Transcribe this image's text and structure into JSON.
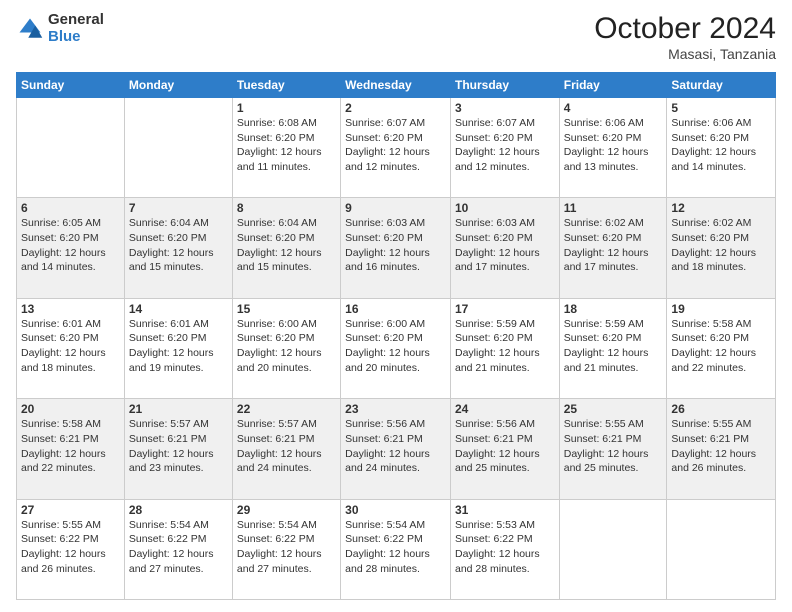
{
  "header": {
    "logo_general": "General",
    "logo_blue": "Blue",
    "month_year": "October 2024",
    "location": "Masasi, Tanzania"
  },
  "days_of_week": [
    "Sunday",
    "Monday",
    "Tuesday",
    "Wednesday",
    "Thursday",
    "Friday",
    "Saturday"
  ],
  "weeks": [
    [
      {
        "day": "",
        "info": ""
      },
      {
        "day": "",
        "info": ""
      },
      {
        "day": "1",
        "info": "Sunrise: 6:08 AM\nSunset: 6:20 PM\nDaylight: 12 hours and 11 minutes."
      },
      {
        "day": "2",
        "info": "Sunrise: 6:07 AM\nSunset: 6:20 PM\nDaylight: 12 hours and 12 minutes."
      },
      {
        "day": "3",
        "info": "Sunrise: 6:07 AM\nSunset: 6:20 PM\nDaylight: 12 hours and 12 minutes."
      },
      {
        "day": "4",
        "info": "Sunrise: 6:06 AM\nSunset: 6:20 PM\nDaylight: 12 hours and 13 minutes."
      },
      {
        "day": "5",
        "info": "Sunrise: 6:06 AM\nSunset: 6:20 PM\nDaylight: 12 hours and 14 minutes."
      }
    ],
    [
      {
        "day": "6",
        "info": "Sunrise: 6:05 AM\nSunset: 6:20 PM\nDaylight: 12 hours and 14 minutes."
      },
      {
        "day": "7",
        "info": "Sunrise: 6:04 AM\nSunset: 6:20 PM\nDaylight: 12 hours and 15 minutes."
      },
      {
        "day": "8",
        "info": "Sunrise: 6:04 AM\nSunset: 6:20 PM\nDaylight: 12 hours and 15 minutes."
      },
      {
        "day": "9",
        "info": "Sunrise: 6:03 AM\nSunset: 6:20 PM\nDaylight: 12 hours and 16 minutes."
      },
      {
        "day": "10",
        "info": "Sunrise: 6:03 AM\nSunset: 6:20 PM\nDaylight: 12 hours and 17 minutes."
      },
      {
        "day": "11",
        "info": "Sunrise: 6:02 AM\nSunset: 6:20 PM\nDaylight: 12 hours and 17 minutes."
      },
      {
        "day": "12",
        "info": "Sunrise: 6:02 AM\nSunset: 6:20 PM\nDaylight: 12 hours and 18 minutes."
      }
    ],
    [
      {
        "day": "13",
        "info": "Sunrise: 6:01 AM\nSunset: 6:20 PM\nDaylight: 12 hours and 18 minutes."
      },
      {
        "day": "14",
        "info": "Sunrise: 6:01 AM\nSunset: 6:20 PM\nDaylight: 12 hours and 19 minutes."
      },
      {
        "day": "15",
        "info": "Sunrise: 6:00 AM\nSunset: 6:20 PM\nDaylight: 12 hours and 20 minutes."
      },
      {
        "day": "16",
        "info": "Sunrise: 6:00 AM\nSunset: 6:20 PM\nDaylight: 12 hours and 20 minutes."
      },
      {
        "day": "17",
        "info": "Sunrise: 5:59 AM\nSunset: 6:20 PM\nDaylight: 12 hours and 21 minutes."
      },
      {
        "day": "18",
        "info": "Sunrise: 5:59 AM\nSunset: 6:20 PM\nDaylight: 12 hours and 21 minutes."
      },
      {
        "day": "19",
        "info": "Sunrise: 5:58 AM\nSunset: 6:20 PM\nDaylight: 12 hours and 22 minutes."
      }
    ],
    [
      {
        "day": "20",
        "info": "Sunrise: 5:58 AM\nSunset: 6:21 PM\nDaylight: 12 hours and 22 minutes."
      },
      {
        "day": "21",
        "info": "Sunrise: 5:57 AM\nSunset: 6:21 PM\nDaylight: 12 hours and 23 minutes."
      },
      {
        "day": "22",
        "info": "Sunrise: 5:57 AM\nSunset: 6:21 PM\nDaylight: 12 hours and 24 minutes."
      },
      {
        "day": "23",
        "info": "Sunrise: 5:56 AM\nSunset: 6:21 PM\nDaylight: 12 hours and 24 minutes."
      },
      {
        "day": "24",
        "info": "Sunrise: 5:56 AM\nSunset: 6:21 PM\nDaylight: 12 hours and 25 minutes."
      },
      {
        "day": "25",
        "info": "Sunrise: 5:55 AM\nSunset: 6:21 PM\nDaylight: 12 hours and 25 minutes."
      },
      {
        "day": "26",
        "info": "Sunrise: 5:55 AM\nSunset: 6:21 PM\nDaylight: 12 hours and 26 minutes."
      }
    ],
    [
      {
        "day": "27",
        "info": "Sunrise: 5:55 AM\nSunset: 6:22 PM\nDaylight: 12 hours and 26 minutes."
      },
      {
        "day": "28",
        "info": "Sunrise: 5:54 AM\nSunset: 6:22 PM\nDaylight: 12 hours and 27 minutes."
      },
      {
        "day": "29",
        "info": "Sunrise: 5:54 AM\nSunset: 6:22 PM\nDaylight: 12 hours and 27 minutes."
      },
      {
        "day": "30",
        "info": "Sunrise: 5:54 AM\nSunset: 6:22 PM\nDaylight: 12 hours and 28 minutes."
      },
      {
        "day": "31",
        "info": "Sunrise: 5:53 AM\nSunset: 6:22 PM\nDaylight: 12 hours and 28 minutes."
      },
      {
        "day": "",
        "info": ""
      },
      {
        "day": "",
        "info": ""
      }
    ]
  ]
}
